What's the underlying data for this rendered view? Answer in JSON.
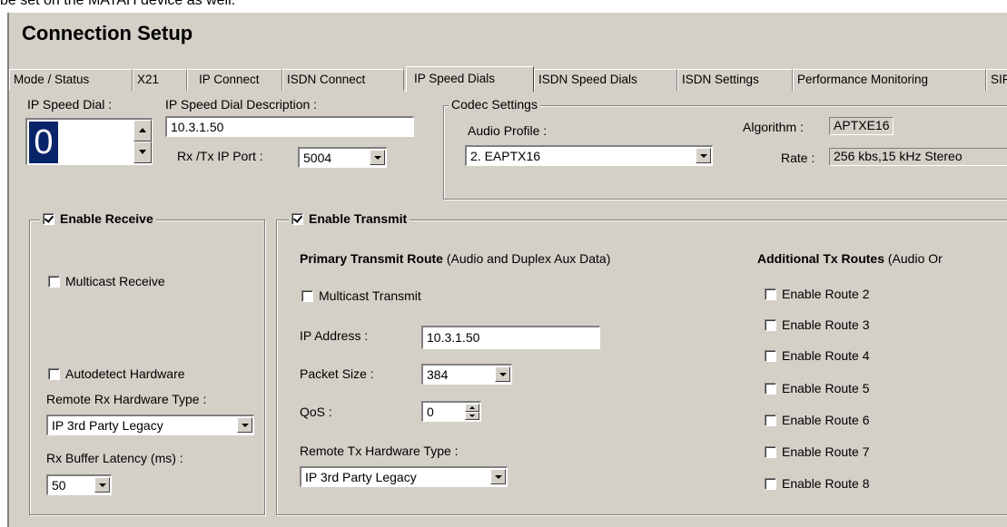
{
  "top_text": "be set on the MATAH device as well.",
  "title": "Connection Setup",
  "tabs": [
    {
      "label": "Mode / Status"
    },
    {
      "label": "X21"
    },
    {
      "label": "IP Connect"
    },
    {
      "label": "ISDN Connect"
    },
    {
      "label": "IP Speed Dials"
    },
    {
      "label": "ISDN Speed Dials"
    },
    {
      "label": "ISDN Settings"
    },
    {
      "label": "Performance Monitoring"
    },
    {
      "label": "SIF"
    }
  ],
  "active_tab": "IP Speed Dials",
  "speed_dial": {
    "label": "IP Speed Dial :",
    "value": "0",
    "description_label": "IP Speed Dial Description :",
    "description_value": "10.3.1.50",
    "port_label": "Rx /Tx IP Port :",
    "port_value": "5004"
  },
  "codec": {
    "legend": "Codec Settings",
    "audio_profile_label": "Audio Profile :",
    "audio_profile_value": "2. EAPTX16",
    "algorithm_label": "Algorithm :",
    "algorithm_value": "APTXE16",
    "rate_label": "Rate :",
    "rate_value": "256 kbs,15 kHz Stereo"
  },
  "receive": {
    "legend": "Enable Receive",
    "enabled": true,
    "multicast_label": "Multicast Receive",
    "autodetect_label": "Autodetect Hardware",
    "hw_type_label": "Remote Rx Hardware Type :",
    "hw_type_value": "IP 3rd Party Legacy",
    "latency_label": "Rx Buffer Latency (ms) :",
    "latency_value": "50"
  },
  "transmit": {
    "legend": "Enable Transmit",
    "enabled": true,
    "primary_title": "Primary Transmit Route",
    "primary_note": "(Audio and Duplex Aux Data)",
    "multicast_label": "Multicast Transmit",
    "ip_label": "IP Address :",
    "ip_value": "10.3.1.50",
    "packet_label": "Packet Size :",
    "packet_value": "384",
    "qos_label": "QoS :",
    "qos_value": "0",
    "hw_type_label": "Remote Tx Hardware Type :",
    "hw_type_value": "IP 3rd Party Legacy",
    "additional_title": "Additional Tx Routes",
    "additional_note": "(Audio Or",
    "routes": [
      "Enable Route 2",
      "Enable Route 3",
      "Enable Route 4",
      "Enable Route 5",
      "Enable Route 6",
      "Enable Route 7",
      "Enable Route 8"
    ]
  }
}
